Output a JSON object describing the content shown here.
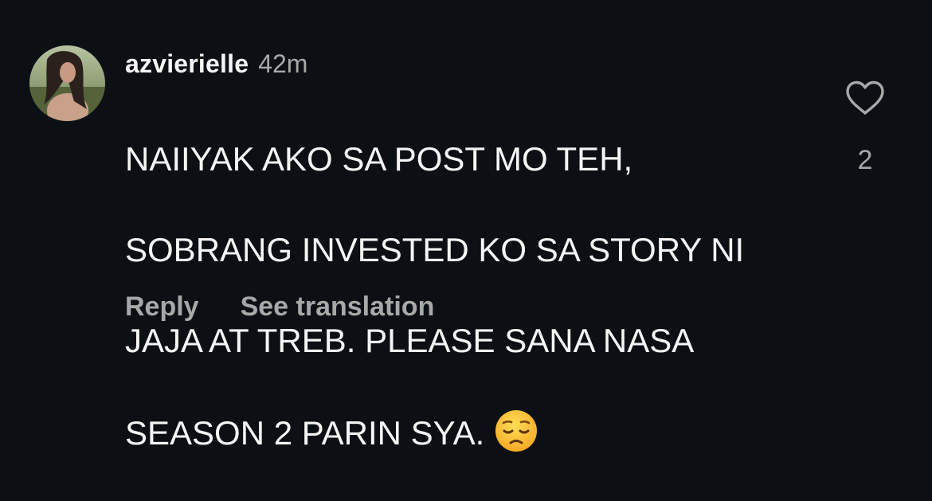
{
  "comment": {
    "username": "azvierielle",
    "timestamp": "42m",
    "text_lines": [
      "NAIIYAK AKO SA POST MO TEH,",
      "SOBRANG INVESTED KO SA STORY NI",
      "JAJA AT TREB. PLEASE SANA NASA",
      "SEASON 2 PARIN SYA."
    ],
    "emoji": "pensive-face",
    "like_count": "2",
    "actions": {
      "reply_label": "Reply",
      "translate_label": "See translation"
    },
    "icons": {
      "like": "heart-outline-icon"
    }
  },
  "colors": {
    "background": "#0c1014",
    "primary_text": "#f5f5f5",
    "secondary_text": "#a8a8a8"
  }
}
